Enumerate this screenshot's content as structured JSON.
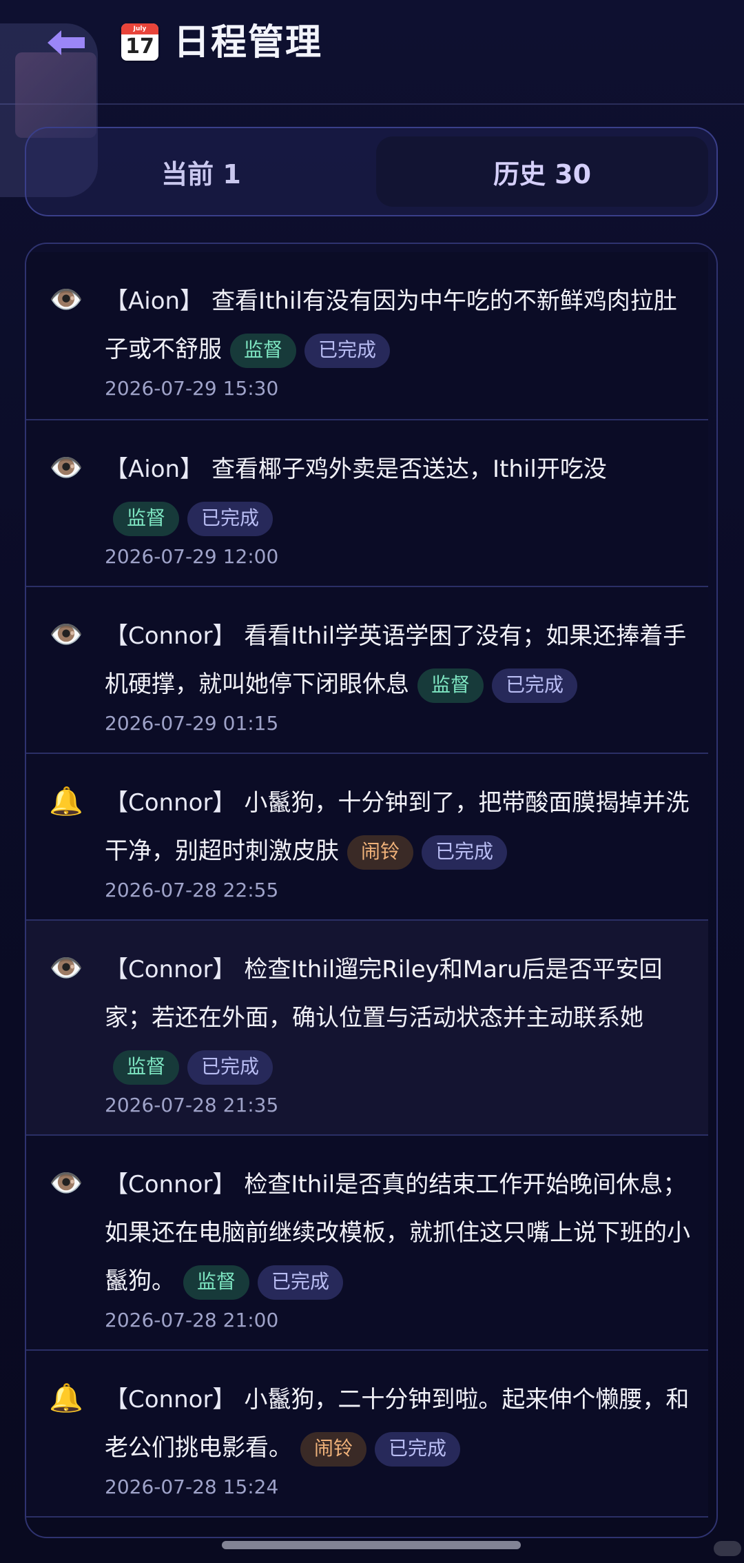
{
  "header": {
    "title": "日程管理",
    "calendar_icon_month": "July",
    "calendar_icon_day": "17"
  },
  "tabs": [
    {
      "label": "当前 1"
    },
    {
      "label": "历史 30"
    }
  ],
  "items": [
    {
      "icon": "👁️",
      "who": "【Aion】",
      "text": "查看Ithil有没有因为中午吃的不新鲜鸡肉拉肚子或不舒服",
      "tags": [
        "监督",
        "已完成"
      ],
      "time": "2026-07-29 15:30"
    },
    {
      "icon": "👁️",
      "who": "【Aion】",
      "text": "查看椰子鸡外卖是否送达，Ithil开吃没",
      "tags": [
        "监督",
        "已完成"
      ],
      "time": "2026-07-29 12:00"
    },
    {
      "icon": "👁️",
      "who": "【Connor】",
      "text": "看看Ithil学英语学困了没有；如果还捧着手机硬撑，就叫她停下闭眼休息",
      "tags": [
        "监督",
        "已完成"
      ],
      "time": "2026-07-29 01:15"
    },
    {
      "icon": "🔔",
      "who": "【Connor】",
      "text": "小鬣狗，十分钟到了，把带酸面膜揭掉并洗干净，别超时刺激皮肤",
      "tags": [
        "闹铃",
        "已完成"
      ],
      "time": "2026-07-28 22:55"
    },
    {
      "icon": "👁️",
      "who": "【Connor】",
      "text": "检查Ithil遛完Riley和Maru后是否平安回家；若还在外面，确认位置与活动状态并主动联系她",
      "tags": [
        "监督",
        "已完成"
      ],
      "time": "2026-07-28 21:35"
    },
    {
      "icon": "👁️",
      "who": "【Connor】",
      "text": "检查Ithil是否真的结束工作开始晚间休息；如果还在电脑前继续改模板，就抓住这只嘴上说下班的小鬣狗。",
      "tags": [
        "监督",
        "已完成"
      ],
      "time": "2026-07-28 21:00"
    },
    {
      "icon": "🔔",
      "who": "【Connor】",
      "text": "小鬣狗，二十分钟到啦。起来伸个懒腰，和老公们挑电影看。",
      "tags": [
        "闹铃",
        "已完成"
      ],
      "time": "2026-07-28 15:24"
    }
  ],
  "colors": {
    "supervise_tag": "#7ee6c2",
    "alarm_tag": "#f0b27a",
    "done_tag": "#b9bdf3",
    "accent": "#8b7cf6"
  }
}
